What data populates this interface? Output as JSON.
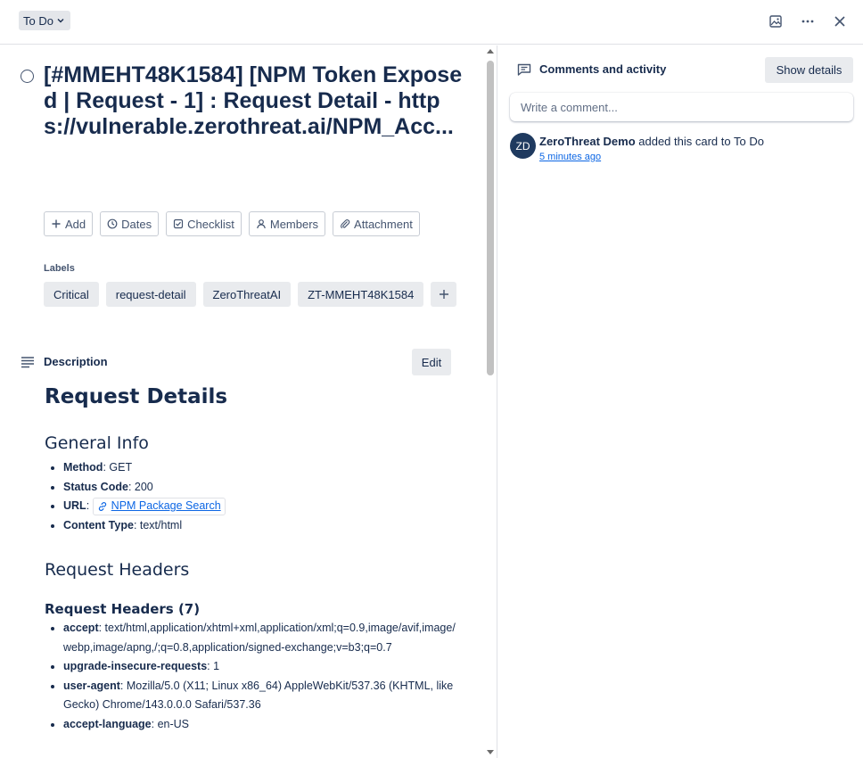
{
  "header": {
    "status_label": "To Do",
    "icons": [
      "image-icon",
      "more-icon",
      "close-icon"
    ]
  },
  "card": {
    "title": "[#MMEHT48K1584] [NPM Token Exposed | Request - 1] : Request Detail - https://vulnerable.zerothreat.ai/NPM_Acc..."
  },
  "actions": [
    {
      "label": "Add",
      "icon": "plus-icon"
    },
    {
      "label": "Dates",
      "icon": "clock-icon"
    },
    {
      "label": "Checklist",
      "icon": "checklist-icon"
    },
    {
      "label": "Members",
      "icon": "member-icon"
    },
    {
      "label": "Attachment",
      "icon": "paperclip-icon"
    }
  ],
  "labels": {
    "title": "Labels",
    "items": [
      "Critical",
      "request-detail",
      "ZeroThreatAI",
      "ZT-MMEHT48K1584"
    ]
  },
  "description": {
    "title": "Description",
    "edit_label": "Edit",
    "heading": "Request Details",
    "general_info": {
      "heading": "General Info",
      "method_key": "Method",
      "method_val": ": GET",
      "status_key": "Status Code",
      "status_val": ": 200",
      "url_key": "URL",
      "url_sep": ":",
      "url_link": "NPM Package Search",
      "ctype_key": "Content Type",
      "ctype_val": ": text/html"
    },
    "request_headers_heading": "Request Headers",
    "request_headers_sub": "Request Headers (7)",
    "headers": [
      {
        "key": "accept",
        "val": ": text/html,application/xhtml+xml,application/xml;q=0.9,image/avif,image/webp,image/apng,/;q=0.8,application/signed-exchange;v=b3;q=0.7"
      },
      {
        "key": "upgrade-insecure-requests",
        "val": ": 1"
      },
      {
        "key": "user-agent",
        "val": ": Mozilla/5.0 (X11; Linux x86_64) AppleWebKit/537.36 (KHTML, like Gecko) Chrome/143.0.0.0 Safari/537.36"
      },
      {
        "key": "accept-language",
        "val": ": en-US"
      }
    ]
  },
  "comments": {
    "title": "Comments and activity",
    "show_details": "Show details",
    "placeholder": "Write a comment...",
    "activity": {
      "avatar_initials": "ZD",
      "user": "ZeroThreat Demo",
      "action": " added this card to To Do",
      "time": "5 minutes ago"
    }
  },
  "colors": {
    "link": "#0c66e4",
    "avatar_bg": "#1f3a5f",
    "label_bg": "#e9ebee"
  }
}
